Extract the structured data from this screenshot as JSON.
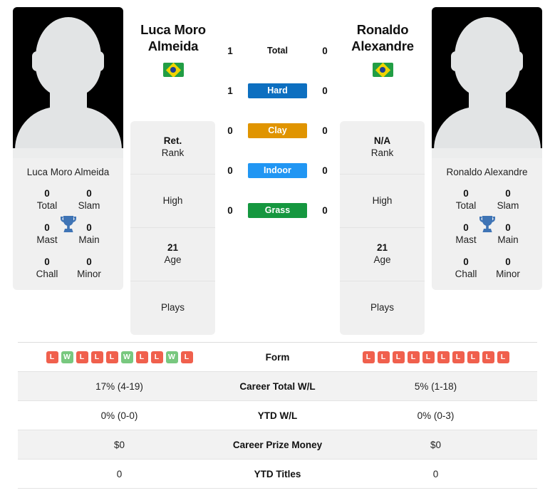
{
  "players": {
    "left": {
      "name_line1": "Luca Moro",
      "name_line2": "Almeida",
      "full_name": "Luca Moro Almeida",
      "flag": "brazil-flag",
      "avatar": "player-silhouette-avatar",
      "titles": [
        {
          "value": "0",
          "label": "Total"
        },
        {
          "value": "0",
          "label": "Slam"
        },
        {
          "value": "0",
          "label": "Mast"
        },
        {
          "value": "0",
          "label": "Main"
        },
        {
          "value": "0",
          "label": "Chall"
        },
        {
          "value": "0",
          "label": "Minor"
        }
      ],
      "stats": [
        {
          "value": "Ret.",
          "label": "Rank"
        },
        {
          "value": "",
          "label": "High"
        },
        {
          "value": "21",
          "label": "Age"
        },
        {
          "value": "",
          "label": "Plays"
        }
      ]
    },
    "right": {
      "name_line1": "Ronaldo",
      "name_line2": "Alexandre",
      "full_name": "Ronaldo Alexandre",
      "flag": "brazil-flag",
      "avatar": "player-silhouette-avatar",
      "titles": [
        {
          "value": "0",
          "label": "Total"
        },
        {
          "value": "0",
          "label": "Slam"
        },
        {
          "value": "0",
          "label": "Mast"
        },
        {
          "value": "0",
          "label": "Main"
        },
        {
          "value": "0",
          "label": "Chall"
        },
        {
          "value": "0",
          "label": "Minor"
        }
      ],
      "stats": [
        {
          "value": "N/A",
          "label": "Rank"
        },
        {
          "value": "",
          "label": "High"
        },
        {
          "value": "21",
          "label": "Age"
        },
        {
          "value": "",
          "label": "Plays"
        }
      ]
    }
  },
  "h2h": {
    "surfaces": [
      {
        "label": "Total",
        "left": "1",
        "right": "0",
        "color": "",
        "style": "plain"
      },
      {
        "label": "Hard",
        "left": "1",
        "right": "0",
        "color": "#0d6fc0",
        "style": "badge"
      },
      {
        "label": "Clay",
        "left": "0",
        "right": "0",
        "color": "#e09400",
        "style": "badge"
      },
      {
        "label": "Indoor",
        "left": "0",
        "right": "0",
        "color": "#2196f3",
        "style": "badge"
      },
      {
        "label": "Grass",
        "left": "0",
        "right": "0",
        "color": "#15973f",
        "style": "badge"
      }
    ]
  },
  "comparison": {
    "rows": [
      {
        "label": "Form",
        "type": "form",
        "left_form": [
          "L",
          "W",
          "L",
          "L",
          "L",
          "W",
          "L",
          "L",
          "W",
          "L"
        ],
        "right_form": [
          "L",
          "L",
          "L",
          "L",
          "L",
          "L",
          "L",
          "L",
          "L",
          "L"
        ],
        "shaded": false
      },
      {
        "label": "Career Total W/L",
        "type": "text",
        "left": "17% (4-19)",
        "right": "5% (1-18)",
        "shaded": true
      },
      {
        "label": "YTD W/L",
        "type": "text",
        "left": "0% (0-0)",
        "right": "0% (0-3)",
        "shaded": false
      },
      {
        "label": "Career Prize Money",
        "type": "text",
        "left": "$0",
        "right": "$0",
        "shaded": true
      },
      {
        "label": "YTD Titles",
        "type": "text",
        "left": "0",
        "right": "0",
        "shaded": false
      }
    ]
  },
  "colors": {
    "win": "#78c87f",
    "loss": "#f0604d",
    "card_bg": "#f0f0f0",
    "row_shade": "#f2f2f2",
    "trophy": "#3f74b5"
  }
}
